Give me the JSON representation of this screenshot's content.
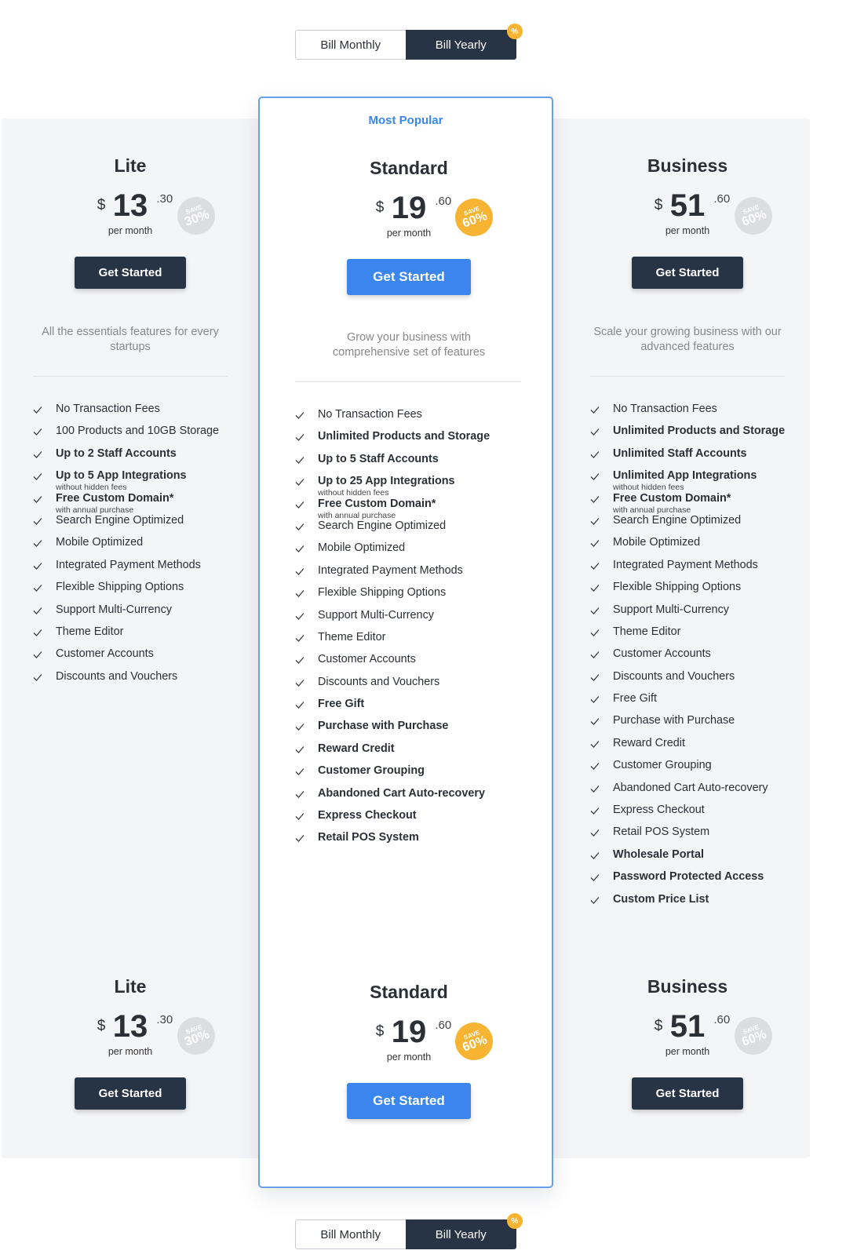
{
  "toggle": {
    "monthly": "Bill Monthly",
    "yearly": "Bill Yearly",
    "badge": "%"
  },
  "accent": {
    "blue": "#3a86ee",
    "dark": "#263445",
    "gold": "#f7b332",
    "border": "#6aa0ea"
  },
  "plans": {
    "lite": {
      "name": "Lite",
      "currency": "$",
      "price_int": "13",
      "price_dec": ".30",
      "save_top": "SAVE",
      "save_pct": "30%",
      "per": "per month",
      "cta": "Get Started",
      "desc": "All the essentials features for every startups"
    },
    "standard": {
      "badge": "Most Popular",
      "name": "Standard",
      "currency": "$",
      "price_int": "19",
      "price_dec": ".60",
      "save_top": "SAVE",
      "save_pct": "60%",
      "per": "per month",
      "cta": "Get Started",
      "desc": "Grow your business with comprehensive set of features"
    },
    "business": {
      "name": "Business",
      "currency": "$",
      "price_int": "51",
      "price_dec": ".60",
      "save_top": "SAVE",
      "save_pct": "60%",
      "per": "per month",
      "cta": "Get Started",
      "desc": "Scale your growing business with our advanced features"
    }
  },
  "features": {
    "lite": [
      {
        "t": "No Transaction Fees",
        "b": false
      },
      {
        "t": "100 Products and 10GB Storage",
        "b": false
      },
      {
        "t": "Up to 2 Staff Accounts",
        "b": true
      },
      {
        "t": "Up to 5 App Integrations",
        "b": true,
        "sub": "without hidden fees"
      },
      {
        "t": "Free Custom Domain*",
        "b": true,
        "sub": "with annual purchase"
      },
      {
        "t": "Search Engine Optimized",
        "b": false
      },
      {
        "t": "Mobile Optimized",
        "b": false
      },
      {
        "t": "Integrated Payment Methods",
        "b": false
      },
      {
        "t": "Flexible Shipping Options",
        "b": false
      },
      {
        "t": "Support Multi-Currency",
        "b": false
      },
      {
        "t": "Theme Editor",
        "b": false
      },
      {
        "t": "Customer Accounts",
        "b": false
      },
      {
        "t": "Discounts and Vouchers",
        "b": false
      }
    ],
    "standard": [
      {
        "t": "No Transaction Fees",
        "b": false
      },
      {
        "t": "Unlimited Products and Storage",
        "b": true
      },
      {
        "t": "Up to 5 Staff Accounts",
        "b": true
      },
      {
        "t": "Up to 25 App Integrations",
        "b": true,
        "sub": "without hidden fees"
      },
      {
        "t": "Free Custom Domain*",
        "b": true,
        "sub": "with annual purchase"
      },
      {
        "t": "Search Engine Optimized",
        "b": false
      },
      {
        "t": "Mobile Optimized",
        "b": false
      },
      {
        "t": "Integrated Payment Methods",
        "b": false
      },
      {
        "t": "Flexible Shipping Options",
        "b": false
      },
      {
        "t": "Support Multi-Currency",
        "b": false
      },
      {
        "t": "Theme Editor",
        "b": false
      },
      {
        "t": "Customer Accounts",
        "b": false
      },
      {
        "t": "Discounts and Vouchers",
        "b": false
      },
      {
        "t": "Free Gift",
        "b": true
      },
      {
        "t": "Purchase with Purchase",
        "b": true
      },
      {
        "t": "Reward Credit",
        "b": true
      },
      {
        "t": "Customer Grouping",
        "b": true
      },
      {
        "t": "Abandoned Cart Auto-recovery",
        "b": true
      },
      {
        "t": "Express Checkout",
        "b": true
      },
      {
        "t": "Retail POS System",
        "b": true
      }
    ],
    "business": [
      {
        "t": "No Transaction Fees",
        "b": false
      },
      {
        "t": "Unlimited Products and Storage",
        "b": true
      },
      {
        "t": "Unlimited Staff Accounts",
        "b": true
      },
      {
        "t": "Unlimited App Integrations",
        "b": true,
        "sub": "without hidden fees"
      },
      {
        "t": "Free Custom Domain*",
        "b": true,
        "sub": "with annual purchase"
      },
      {
        "t": "Search Engine Optimized",
        "b": false
      },
      {
        "t": "Mobile Optimized",
        "b": false
      },
      {
        "t": "Integrated Payment Methods",
        "b": false
      },
      {
        "t": "Flexible Shipping Options",
        "b": false
      },
      {
        "t": "Support Multi-Currency",
        "b": false
      },
      {
        "t": "Theme Editor",
        "b": false
      },
      {
        "t": "Customer Accounts",
        "b": false
      },
      {
        "t": "Discounts and Vouchers",
        "b": false
      },
      {
        "t": "Free Gift",
        "b": false
      },
      {
        "t": "Purchase with Purchase",
        "b": false
      },
      {
        "t": "Reward Credit",
        "b": false
      },
      {
        "t": "Customer Grouping",
        "b": false
      },
      {
        "t": "Abandoned Cart Auto-recovery",
        "b": false
      },
      {
        "t": "Express Checkout",
        "b": false
      },
      {
        "t": "Retail POS System",
        "b": false
      },
      {
        "t": "Wholesale Portal",
        "b": true
      },
      {
        "t": "Password Protected Access",
        "b": true
      },
      {
        "t": "Custom Price List",
        "b": true
      }
    ]
  }
}
